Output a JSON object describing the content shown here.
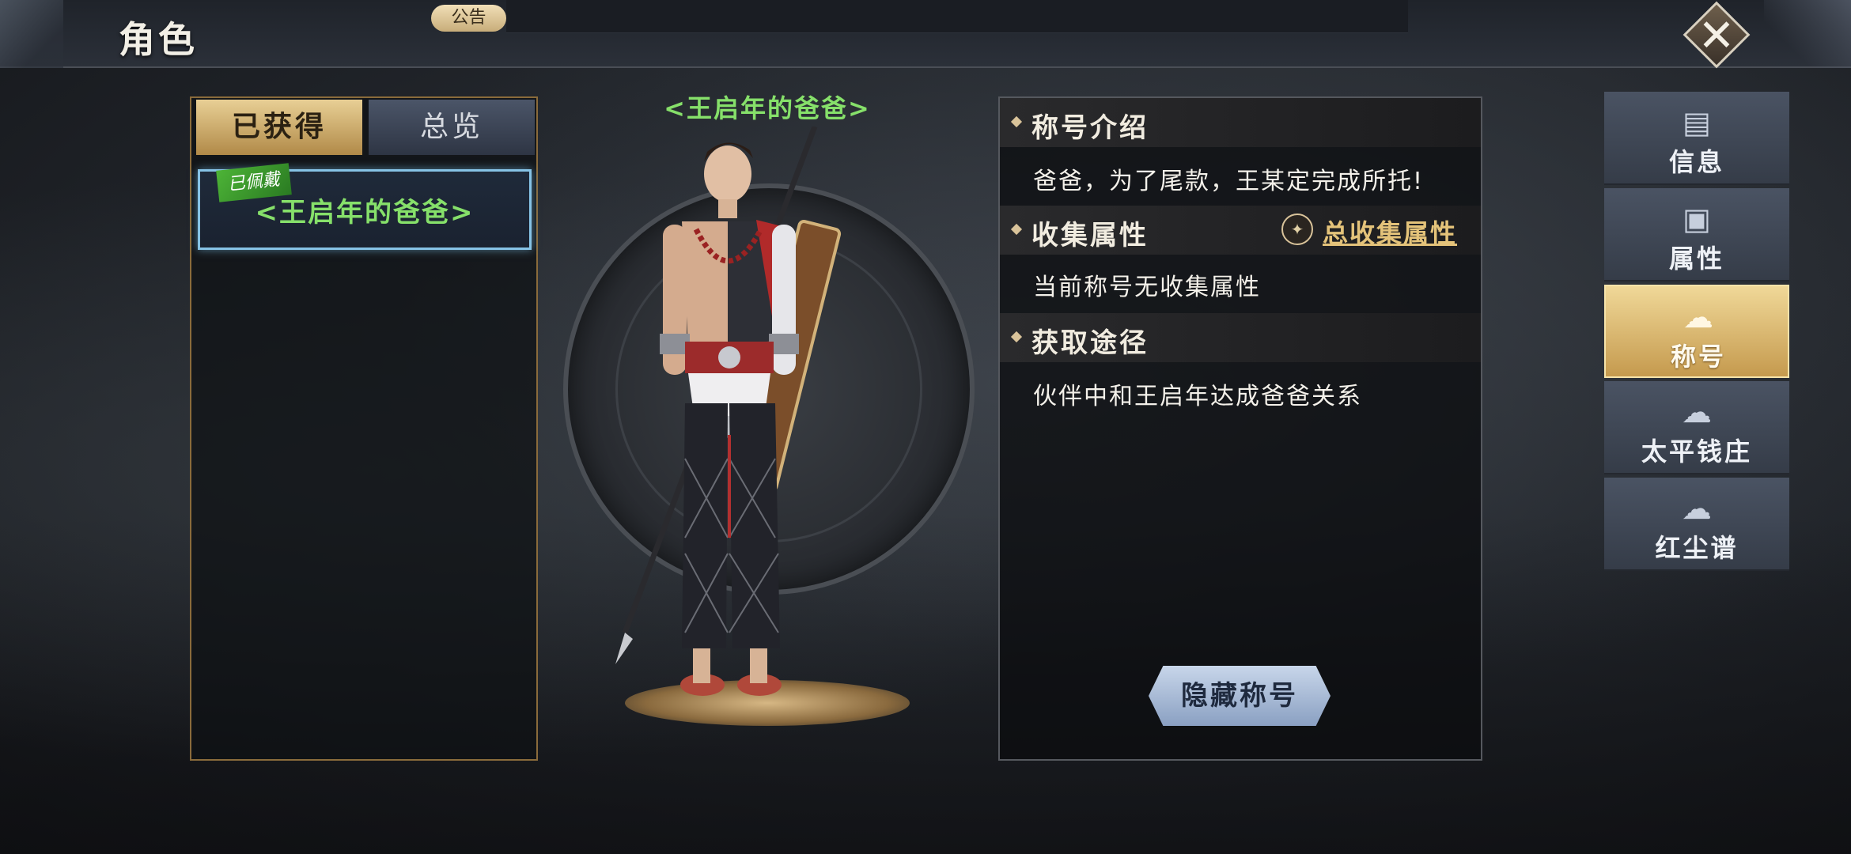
{
  "header": {
    "title": "角色",
    "notice_label": "公告",
    "close_symbol": "✕"
  },
  "list_panel": {
    "tabs": [
      {
        "label": "已获得",
        "active": true
      },
      {
        "label": "总览",
        "active": false
      }
    ],
    "items": [
      {
        "title": "<王启年的爸爸>",
        "badge": "已佩戴",
        "selected": true
      }
    ]
  },
  "character": {
    "title_display": "<王启年的爸爸>"
  },
  "info": {
    "intro": {
      "heading": "称号介绍",
      "text": "爸爸，为了尾款，王某定完成所托!"
    },
    "collect": {
      "heading": "收集属性",
      "link": "总收集属性",
      "text": "当前称号无收集属性"
    },
    "obtain": {
      "heading": "获取途径",
      "text": "伙伴中和王启年达成爸爸关系"
    },
    "hide_button": "隐藏称号"
  },
  "side_nav": [
    {
      "label": "信息",
      "icon": "scroll-icon",
      "active": false
    },
    {
      "label": "属性",
      "icon": "profile-card-icon",
      "active": false
    },
    {
      "label": "称号",
      "icon": "cloud-icon",
      "active": true
    },
    {
      "label": "太平钱庄",
      "icon": "cloud-icon",
      "active": false
    },
    {
      "label": "红尘谱",
      "icon": "cloud-icon",
      "active": false
    }
  ],
  "colors": {
    "title_green": "#86e06a",
    "gold_accent": "#e4c37a",
    "active_tab_gold": "#c59a4e",
    "selection_blue": "#86c3e6"
  }
}
